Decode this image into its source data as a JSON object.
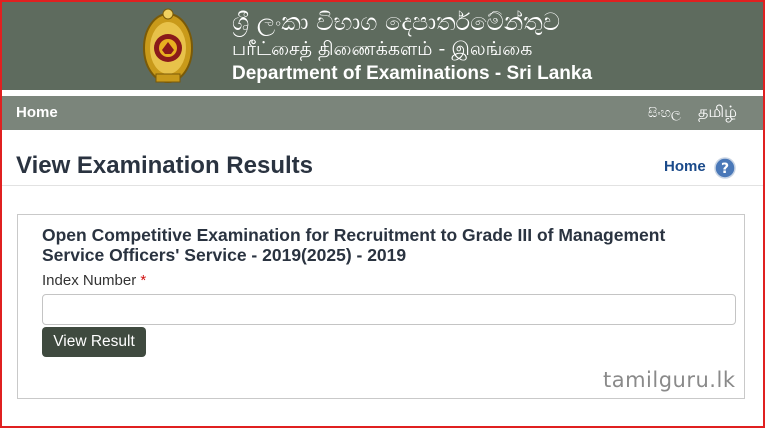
{
  "header": {
    "title_sinhala": "ශ්‍රී ලංකා විභාග දෙපාර්තමේන්තුව",
    "title_tamil": "பரீட்சைத் திணைக்களம் - இலங்கை",
    "title_english": "Department of Examinations - Sri Lanka",
    "emblem_icon": "sri-lanka-emblem-icon"
  },
  "nav": {
    "home": "Home",
    "lang_sinhala": "සිංහල",
    "lang_tamil": "தமிழ்"
  },
  "page": {
    "title": "View Examination Results",
    "home_link": "Home",
    "help_icon": "question-mark-icon"
  },
  "form": {
    "exam_title": "Open Competitive Examination for Recruitment to Grade III of Management Service Officers' Service - 2019(2025) - 2019",
    "index_label": "Index Number",
    "required_mark": "*",
    "index_value": "",
    "submit_label": "View Result"
  },
  "watermark": "tamilguru.lk",
  "colors": {
    "banner": "#5e6b5e",
    "navbar": "#7b857b",
    "button": "#3f4a3f",
    "link": "#1a4a8a",
    "frame": "#e02020"
  }
}
